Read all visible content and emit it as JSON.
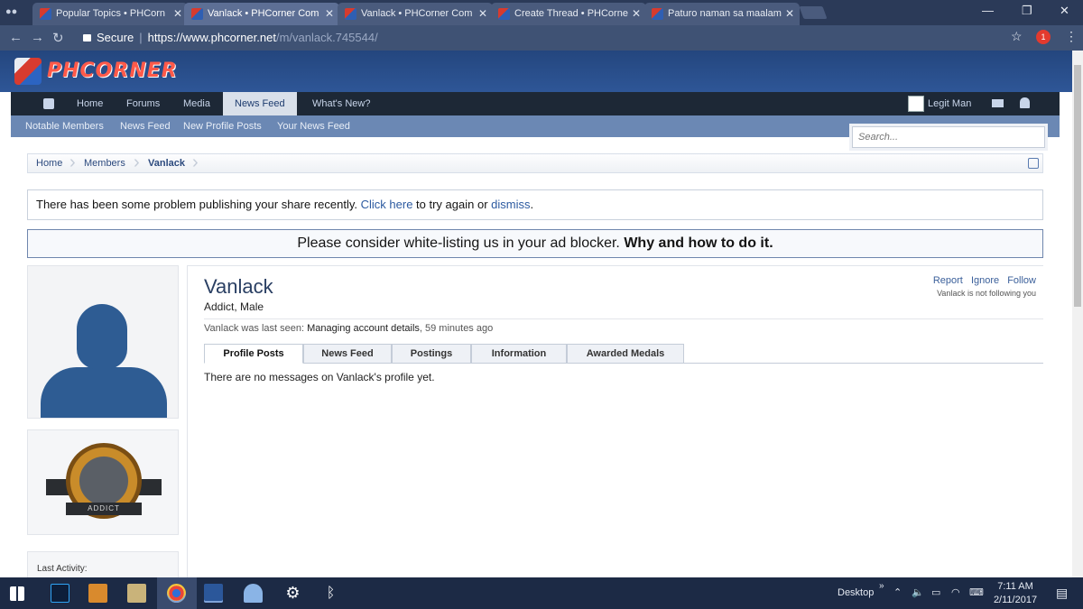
{
  "browser": {
    "tabs": [
      {
        "title": "Popular Topics • PHCorn",
        "active": false
      },
      {
        "title": "Vanlack • PHCorner Com",
        "active": true
      },
      {
        "title": "Vanlack • PHCorner Com",
        "active": false
      },
      {
        "title": "Create Thread • PHCorne",
        "active": false
      },
      {
        "title": "Paturo naman sa maalam",
        "active": false
      }
    ],
    "secure_label": "Secure",
    "url_main": "https://www.phcorner.net",
    "url_path": "/m/vanlack.745544/",
    "extension_badge": "1"
  },
  "site": {
    "logo_text": "PHCORNER",
    "nav": [
      "Home",
      "Forums",
      "Media",
      "News Feed",
      "What's New?"
    ],
    "user_name": "Legit Man",
    "subnav": [
      "Notable Members",
      "News Feed",
      "New Profile Posts",
      "Your News Feed"
    ],
    "search_placeholder": "Search...",
    "breadcrumb": [
      "Home",
      "Members",
      "Vanlack"
    ],
    "notice": {
      "before": "There has been some problem publishing your share recently. ",
      "link1": "Click here",
      "middle": " to try again or ",
      "link2": "dismiss",
      "after": "."
    },
    "adblock": {
      "text": "Please consider white-listing us in your ad blocker. ",
      "bold": "Why and how to do it."
    }
  },
  "profile": {
    "name": "Vanlack",
    "title": "Addict, Male",
    "last_seen_prefix": "Vanlack was last seen: ",
    "last_seen_activity": "Managing account details",
    "last_seen_time": ", 59 minutes ago",
    "actions": [
      "Report",
      "Ignore",
      "Follow"
    ],
    "follow_note": "Vanlack is not following you",
    "tabs": [
      "Profile Posts",
      "News Feed",
      "Postings",
      "Information",
      "Awarded Medals"
    ],
    "empty_message": "There are no messages on Vanlack's profile yet.",
    "medal_label": "ADDICT",
    "sidebar_last_activity": "Last Activity:"
  },
  "taskbar": {
    "desktop_label": "Desktop",
    "time": "7:11 AM",
    "date": "2/11/2017"
  }
}
